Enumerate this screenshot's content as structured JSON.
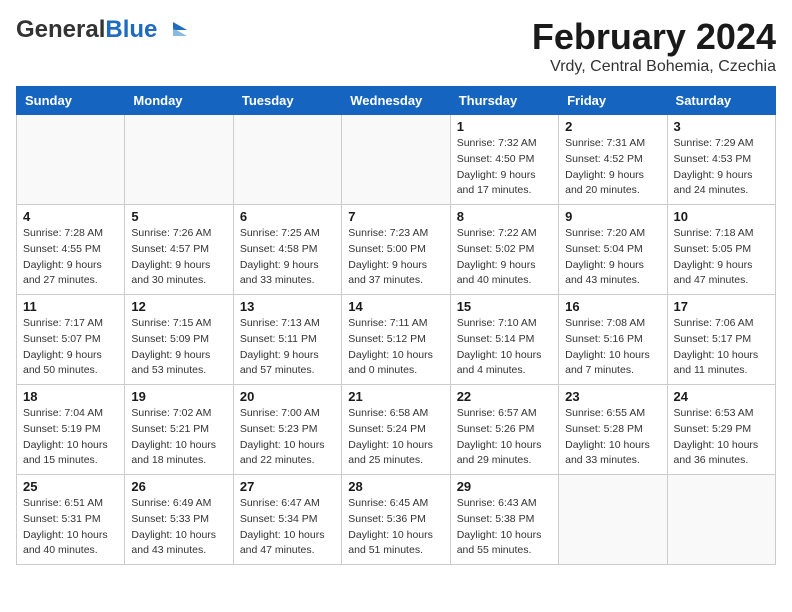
{
  "header": {
    "logo_general": "General",
    "logo_blue": "Blue",
    "month_year": "February 2024",
    "location": "Vrdy, Central Bohemia, Czechia"
  },
  "days_of_week": [
    "Sunday",
    "Monday",
    "Tuesday",
    "Wednesday",
    "Thursday",
    "Friday",
    "Saturday"
  ],
  "weeks": [
    {
      "cells": [
        {
          "day": "",
          "info": ""
        },
        {
          "day": "",
          "info": ""
        },
        {
          "day": "",
          "info": ""
        },
        {
          "day": "",
          "info": ""
        },
        {
          "day": "1",
          "info": "Sunrise: 7:32 AM\nSunset: 4:50 PM\nDaylight: 9 hours\nand 17 minutes."
        },
        {
          "day": "2",
          "info": "Sunrise: 7:31 AM\nSunset: 4:52 PM\nDaylight: 9 hours\nand 20 minutes."
        },
        {
          "day": "3",
          "info": "Sunrise: 7:29 AM\nSunset: 4:53 PM\nDaylight: 9 hours\nand 24 minutes."
        }
      ]
    },
    {
      "cells": [
        {
          "day": "4",
          "info": "Sunrise: 7:28 AM\nSunset: 4:55 PM\nDaylight: 9 hours\nand 27 minutes."
        },
        {
          "day": "5",
          "info": "Sunrise: 7:26 AM\nSunset: 4:57 PM\nDaylight: 9 hours\nand 30 minutes."
        },
        {
          "day": "6",
          "info": "Sunrise: 7:25 AM\nSunset: 4:58 PM\nDaylight: 9 hours\nand 33 minutes."
        },
        {
          "day": "7",
          "info": "Sunrise: 7:23 AM\nSunset: 5:00 PM\nDaylight: 9 hours\nand 37 minutes."
        },
        {
          "day": "8",
          "info": "Sunrise: 7:22 AM\nSunset: 5:02 PM\nDaylight: 9 hours\nand 40 minutes."
        },
        {
          "day": "9",
          "info": "Sunrise: 7:20 AM\nSunset: 5:04 PM\nDaylight: 9 hours\nand 43 minutes."
        },
        {
          "day": "10",
          "info": "Sunrise: 7:18 AM\nSunset: 5:05 PM\nDaylight: 9 hours\nand 47 minutes."
        }
      ]
    },
    {
      "cells": [
        {
          "day": "11",
          "info": "Sunrise: 7:17 AM\nSunset: 5:07 PM\nDaylight: 9 hours\nand 50 minutes."
        },
        {
          "day": "12",
          "info": "Sunrise: 7:15 AM\nSunset: 5:09 PM\nDaylight: 9 hours\nand 53 minutes."
        },
        {
          "day": "13",
          "info": "Sunrise: 7:13 AM\nSunset: 5:11 PM\nDaylight: 9 hours\nand 57 minutes."
        },
        {
          "day": "14",
          "info": "Sunrise: 7:11 AM\nSunset: 5:12 PM\nDaylight: 10 hours\nand 0 minutes."
        },
        {
          "day": "15",
          "info": "Sunrise: 7:10 AM\nSunset: 5:14 PM\nDaylight: 10 hours\nand 4 minutes."
        },
        {
          "day": "16",
          "info": "Sunrise: 7:08 AM\nSunset: 5:16 PM\nDaylight: 10 hours\nand 7 minutes."
        },
        {
          "day": "17",
          "info": "Sunrise: 7:06 AM\nSunset: 5:17 PM\nDaylight: 10 hours\nand 11 minutes."
        }
      ]
    },
    {
      "cells": [
        {
          "day": "18",
          "info": "Sunrise: 7:04 AM\nSunset: 5:19 PM\nDaylight: 10 hours\nand 15 minutes."
        },
        {
          "day": "19",
          "info": "Sunrise: 7:02 AM\nSunset: 5:21 PM\nDaylight: 10 hours\nand 18 minutes."
        },
        {
          "day": "20",
          "info": "Sunrise: 7:00 AM\nSunset: 5:23 PM\nDaylight: 10 hours\nand 22 minutes."
        },
        {
          "day": "21",
          "info": "Sunrise: 6:58 AM\nSunset: 5:24 PM\nDaylight: 10 hours\nand 25 minutes."
        },
        {
          "day": "22",
          "info": "Sunrise: 6:57 AM\nSunset: 5:26 PM\nDaylight: 10 hours\nand 29 minutes."
        },
        {
          "day": "23",
          "info": "Sunrise: 6:55 AM\nSunset: 5:28 PM\nDaylight: 10 hours\nand 33 minutes."
        },
        {
          "day": "24",
          "info": "Sunrise: 6:53 AM\nSunset: 5:29 PM\nDaylight: 10 hours\nand 36 minutes."
        }
      ]
    },
    {
      "cells": [
        {
          "day": "25",
          "info": "Sunrise: 6:51 AM\nSunset: 5:31 PM\nDaylight: 10 hours\nand 40 minutes."
        },
        {
          "day": "26",
          "info": "Sunrise: 6:49 AM\nSunset: 5:33 PM\nDaylight: 10 hours\nand 43 minutes."
        },
        {
          "day": "27",
          "info": "Sunrise: 6:47 AM\nSunset: 5:34 PM\nDaylight: 10 hours\nand 47 minutes."
        },
        {
          "day": "28",
          "info": "Sunrise: 6:45 AM\nSunset: 5:36 PM\nDaylight: 10 hours\nand 51 minutes."
        },
        {
          "day": "29",
          "info": "Sunrise: 6:43 AM\nSunset: 5:38 PM\nDaylight: 10 hours\nand 55 minutes."
        },
        {
          "day": "",
          "info": ""
        },
        {
          "day": "",
          "info": ""
        }
      ]
    }
  ]
}
